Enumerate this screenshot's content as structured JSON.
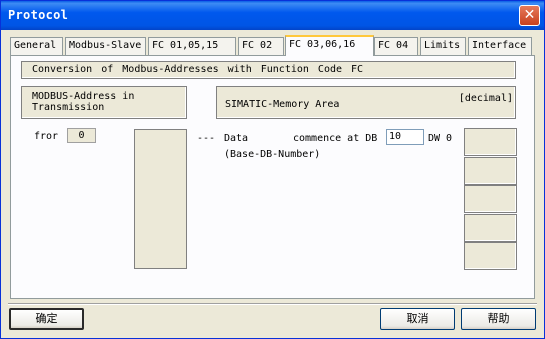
{
  "window": {
    "title": "Protocol",
    "close_symbol": "✕"
  },
  "tabs": [
    {
      "label": "General",
      "active": false
    },
    {
      "label": "Modbus-Slave",
      "active": false
    },
    {
      "label": "FC 01,05,15",
      "active": false
    },
    {
      "label": "FC 02",
      "active": false
    },
    {
      "label": "FC 03,06,16",
      "active": true
    },
    {
      "label": "FC 04",
      "active": false
    },
    {
      "label": "Limits",
      "active": false
    },
    {
      "label": "Interface",
      "active": false
    }
  ],
  "panel": {
    "header": "Conversion of Modbus-Addresses with Function Code FC",
    "modbus_label_1": "MODBUS-Address in",
    "modbus_label_2": "Transmission",
    "simatic_label": "SIMATIC-Memory Area",
    "decimal_label": "[decimal]",
    "from_label": "fror",
    "from_value": "0",
    "dashes": "---",
    "data_label": "Data",
    "commence_label": "commence at DB",
    "db_value": "10",
    "dw_label": "DW 0",
    "base_label": "(Base-DB-Number)"
  },
  "buttons": {
    "ok": "确定",
    "cancel": "取消",
    "help": "帮助"
  }
}
